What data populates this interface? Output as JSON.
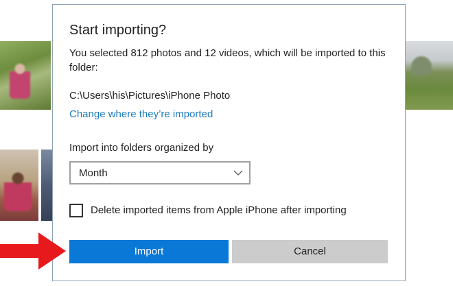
{
  "dialog": {
    "title": "Start importing?",
    "description": "You selected 812 photos and 12 videos, which will be imported to this folder:",
    "folder_path": "C:\\Users\\his\\Pictures\\iPhone Photo",
    "change_link": "Change where they’re imported",
    "organize_label": "Import into folders organized by",
    "organize_select": {
      "selected": "Month"
    },
    "delete_checkbox": {
      "label": "Delete imported items from Apple iPhone after importing",
      "checked": false
    },
    "buttons": {
      "import": "Import",
      "cancel": "Cancel"
    }
  },
  "colors": {
    "accent": "#0a78d7",
    "link": "#1b7bbf",
    "cancel_bg": "#cccccc",
    "annotation_arrow": "#e8191c"
  },
  "icons": {
    "select_chevron": "chevron-down-icon",
    "annotation": "red-arrow-icon"
  }
}
